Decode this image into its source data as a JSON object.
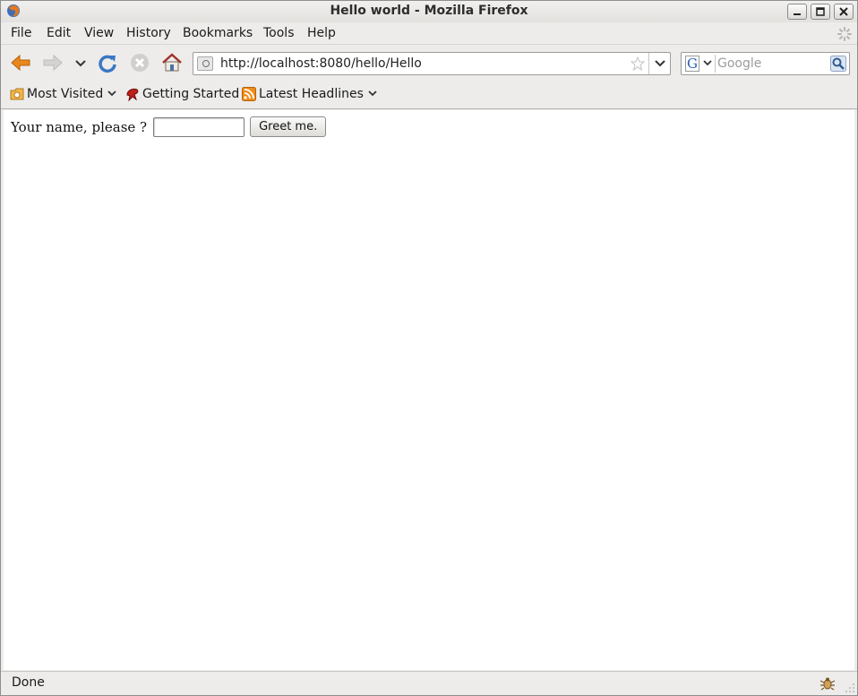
{
  "window": {
    "title": "Hello world - Mozilla Firefox",
    "controls": [
      "minimize",
      "maximize",
      "close"
    ]
  },
  "menubar": {
    "items": [
      {
        "label": "File"
      },
      {
        "label": "Edit"
      },
      {
        "label": "View"
      },
      {
        "label": "History"
      },
      {
        "label": "Bookmarks"
      },
      {
        "label": "Tools"
      },
      {
        "label": "Help"
      }
    ]
  },
  "navbar": {
    "buttons": [
      "back-icon",
      "forward-icon",
      "history-dropdown-icon",
      "reload-icon",
      "stop-icon",
      "home-icon"
    ],
    "url": "http://localhost:8080/hello/Hello",
    "search_placeholder": "Google",
    "search_engine": "G"
  },
  "bookmarks": {
    "items": [
      {
        "label": "Most Visited",
        "icon": "folder-icon",
        "dropdown": true
      },
      {
        "label": "Getting Started",
        "icon": "firefox-bookmark-icon",
        "dropdown": false
      },
      {
        "label": "Latest Headlines",
        "icon": "rss-icon",
        "dropdown": true
      }
    ]
  },
  "page": {
    "prompt_label": "Your name, please ?",
    "name_value": "",
    "submit_label": "Greet me."
  },
  "statusbar": {
    "text": "Done"
  },
  "colors": {
    "chrome": "#edeceb",
    "back_arrow": "#e8891d",
    "reload": "#3a77c4"
  }
}
